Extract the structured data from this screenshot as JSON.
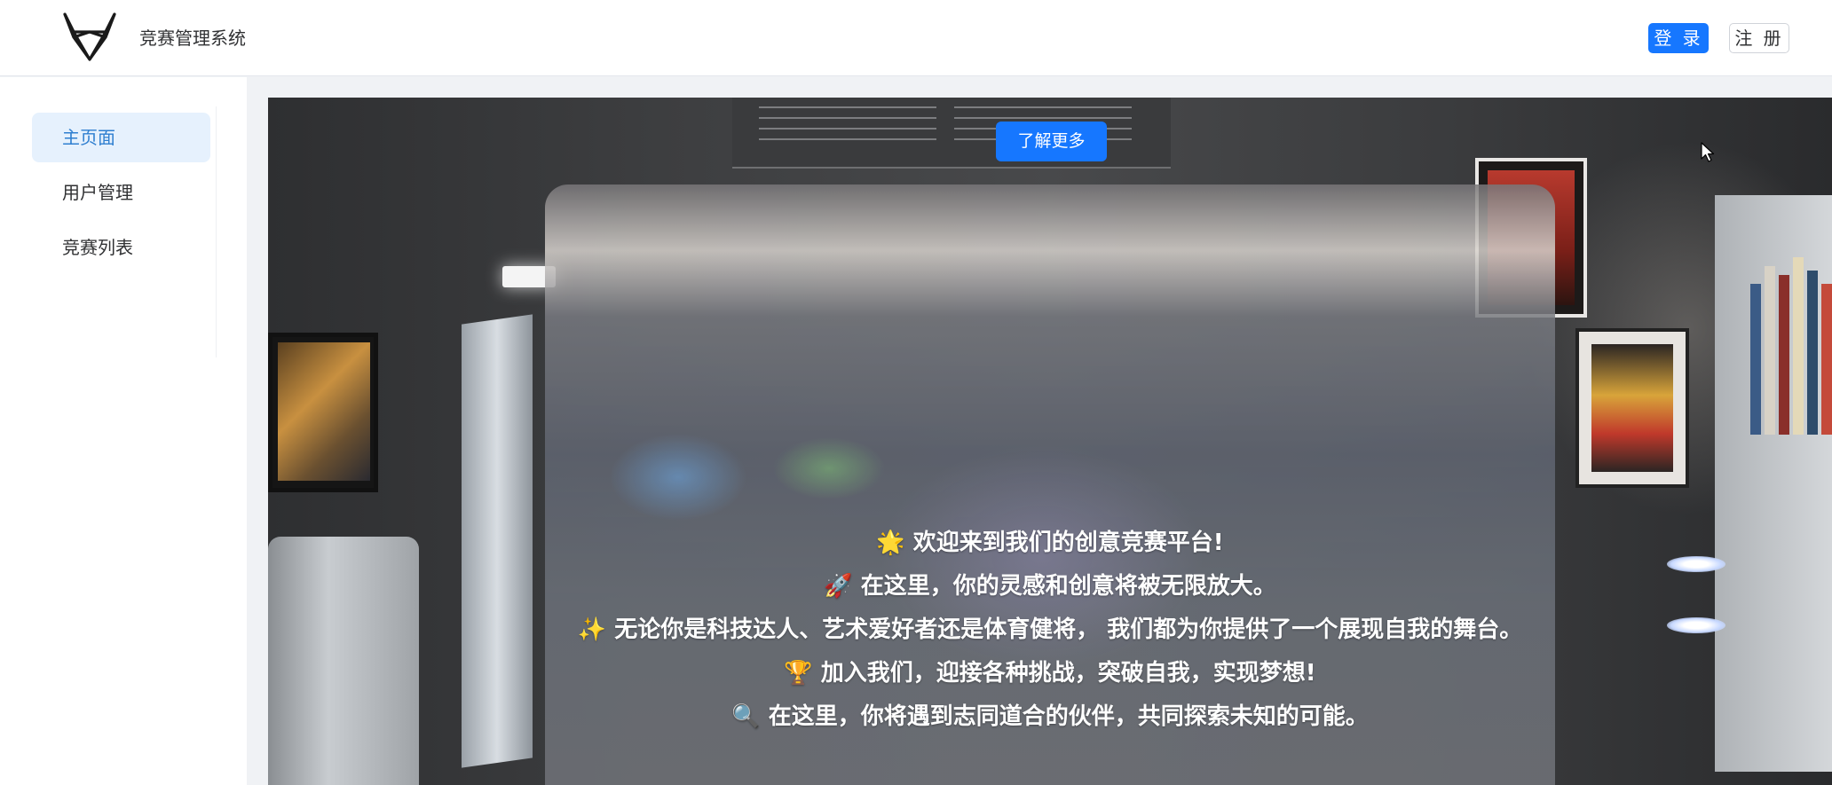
{
  "app": {
    "title": "竞赛管理系统"
  },
  "header": {
    "login_label": "登 录",
    "register_label": "注 册"
  },
  "sidebar": {
    "items": [
      {
        "label": "主页面",
        "active": true
      },
      {
        "label": "用户管理",
        "active": false
      },
      {
        "label": "竞赛列表",
        "active": false
      }
    ]
  },
  "hero": {
    "button_label": "了解更多",
    "lines": [
      {
        "icon": "🌟",
        "text": "欢迎来到我们的创意竞赛平台!"
      },
      {
        "icon": "🚀",
        "text": "在这里，你的灵感和创意将被无限放大。"
      },
      {
        "icon": "✨",
        "text": "无论你是科技达人、艺术爱好者还是体育健将， 我们都为你提供了一个展现自我的舞台。"
      },
      {
        "icon": "🏆",
        "text": "加入我们，迎接各种挑战，突破自我，实现梦想!"
      },
      {
        "icon": "🔍",
        "text": "在这里，你将遇到志同道合的伙伴，共同探索未知的可能。"
      }
    ]
  },
  "colors": {
    "primary": "#1677ff",
    "menu_active_bg": "#e6f1fd",
    "menu_active_text": "#2f7fd0"
  },
  "icons": {
    "logo": "gitlab-fox-logo-icon",
    "cursor": "mouse-pointer-icon"
  }
}
